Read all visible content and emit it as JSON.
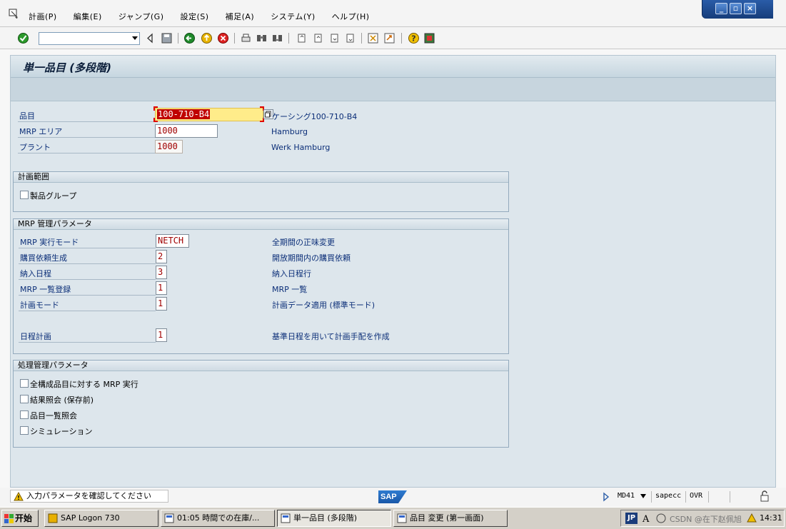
{
  "menu": {
    "items": [
      "計画(P)",
      "編集(E)",
      "ジャンプ(G)",
      "設定(S)",
      "補足(A)",
      "システム(Y)",
      "ヘルプ(H)"
    ]
  },
  "screen": {
    "title": "単一品目 (多段階)"
  },
  "header_fields": {
    "material_label": "品目",
    "material_value": "100-710-B4",
    "material_desc": "ケーシング100-710-B4",
    "mrp_area_label": "MRP エリア",
    "mrp_area_value": "1000",
    "mrp_area_desc": "Hamburg",
    "plant_label": "プラント",
    "plant_value": "1000",
    "plant_desc": "Werk Hamburg"
  },
  "planning_scope": {
    "title": "計画範囲",
    "product_group_label": "製品グループ"
  },
  "mrp_params": {
    "title": "MRP 管理パラメータ",
    "rows": [
      {
        "label": "MRP 実行モード",
        "value": "NETCH",
        "desc": "全期間の正味変更"
      },
      {
        "label": "購買依頼生成",
        "value": "2",
        "desc": "開放期間内の購買依頼"
      },
      {
        "label": "納入日程",
        "value": "3",
        "desc": "納入日程行"
      },
      {
        "label": "MRP 一覧登録",
        "value": "1",
        "desc": "MRP 一覧"
      },
      {
        "label": "計画モード",
        "value": "1",
        "desc": "計画データ適用 (標準モード)"
      },
      {
        "label": "日程計画",
        "value": "1",
        "desc": "基準日程を用いて計画手配を作成"
      }
    ]
  },
  "process_params": {
    "title": "処理管理パラメータ",
    "checkboxes": [
      {
        "label": "全構成品目に対する MRP 実行",
        "checked": false
      },
      {
        "label": "結果照会 (保存前)",
        "checked": false
      },
      {
        "label": "品目一覧照会",
        "checked": false
      },
      {
        "label": "シミュレーション",
        "checked": false
      }
    ]
  },
  "status": {
    "message": "入力パラメータを確認してください",
    "sap_logo": "SAP",
    "transaction": "MD41",
    "server": "sapecc",
    "mode": "OVR"
  },
  "taskbar": {
    "start": "开始",
    "tasks": [
      "SAP Logon 730",
      "01:05 時間での在庫/...",
      "単一品目 (多段階)",
      "品目 変更 (第一画面)"
    ],
    "active_task": 2,
    "ime": "JP",
    "clock": "14:31",
    "watermark": "CSDN @在下赵佩旭"
  },
  "colors": {
    "screen_bg": "#dde6ec",
    "label_blue": "#0b2e78",
    "value_red": "#a00000",
    "focus_yellow": "#ffec8a"
  }
}
